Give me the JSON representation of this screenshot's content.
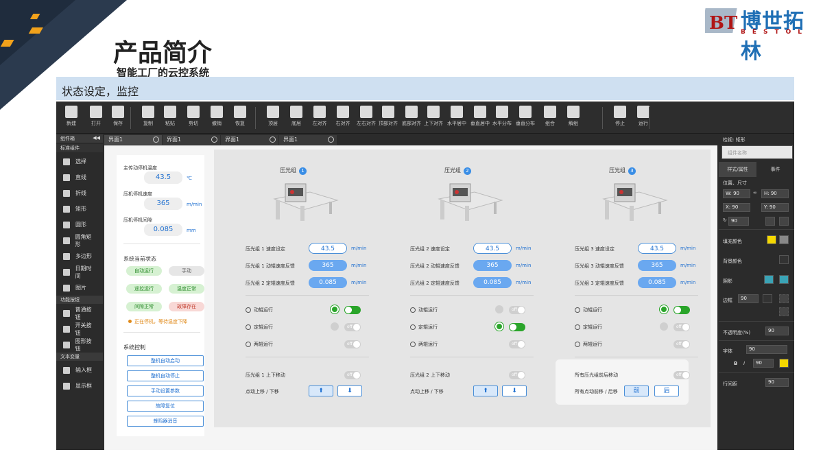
{
  "slide": {
    "title": "产品简介",
    "subtitle": "智能工厂的云控系统",
    "bar_text": "状态设定，监控",
    "logo_text": "博世拓林",
    "logo_sub": "BESTOL",
    "logo_mark": "BT"
  },
  "toolbar": [
    "新建",
    "打开",
    "保存",
    "复制",
    "粘贴",
    "剪切",
    "撤销",
    "恢复",
    "顶层",
    "底层",
    "左对齐",
    "右对齐",
    "左右对齐",
    "顶部对齐",
    "底部对齐",
    "上下对齐",
    "水平居中",
    "垂直居中",
    "水平分布",
    "垂直分布",
    "组合",
    "解组",
    "停止",
    "运行"
  ],
  "left_panel": {
    "header": "组件箱",
    "group1": "标准组件",
    "items1": [
      "选择",
      "直线",
      "折线",
      "矩形",
      "圆形",
      "圆角矩形",
      "多边形",
      "日期时间",
      "图片"
    ],
    "group2": "功能按钮",
    "items2": [
      "普通按钮",
      "开关按钮",
      "图形按钮"
    ],
    "group3": "文本变量",
    "items3": [
      "输入框",
      "显示框"
    ]
  },
  "tabs": [
    "界面1",
    "界面1",
    "界面1",
    "界面1"
  ],
  "control": {
    "f1_label": "主传动停机温度",
    "f1_value": "43.5",
    "f1_unit": "℃",
    "f2_label": "压机停机速度",
    "f2_value": "365",
    "f2_unit": "m/min",
    "f3_label": "压机停机间隙",
    "f3_value": "0.085",
    "f3_unit": "mm",
    "status_title": "系统当前状态",
    "status": [
      "自动运行",
      "手动",
      "遥控运行",
      "温度正常",
      "间隙正常",
      "故障存在"
    ],
    "warning": "正在停机，等待温度下降",
    "ctrl_title": "系统控制",
    "buttons": [
      "整机自动启动",
      "整机自动停止",
      "手动设置参数",
      "故障复位",
      "蜂鸣器消音"
    ]
  },
  "groups": [
    {
      "title": "压光组",
      "num": "1",
      "rows": [
        {
          "label": "压光组 1 速度设定",
          "value": "43.5",
          "unit": "m/min"
        },
        {
          "label": "压光组 1 动辊速度反馈",
          "value": "365",
          "unit": "m/min"
        },
        {
          "label": "压光组 2 定辊速度反馈",
          "value": "0.085",
          "unit": "m/min"
        }
      ],
      "ops": [
        "动辊运行",
        "定辊运行",
        "两辊运行"
      ],
      "bottom1": "压光组 1 上下移动",
      "bottom2": "点动上移 / 下移"
    },
    {
      "title": "压光组",
      "num": "2",
      "rows": [
        {
          "label": "压光组 2 速度设定",
          "value": "43.5",
          "unit": "m/min"
        },
        {
          "label": "压光组 2 动辊速度反馈",
          "value": "365",
          "unit": "m/min"
        },
        {
          "label": "压光组 2 定辊速度反馈",
          "value": "0.085",
          "unit": "m/min"
        }
      ],
      "ops": [
        "动辊运行",
        "定辊运行",
        "两辊运行"
      ],
      "bottom1": "压光组 2 上下移动",
      "bottom2": "点动上移 / 下移"
    },
    {
      "title": "压光组",
      "num": "3",
      "rows": [
        {
          "label": "压光组 3 速度设定",
          "value": "43.5",
          "unit": "m/min"
        },
        {
          "label": "压光组 3 动辊速度反馈",
          "value": "365",
          "unit": "m/min"
        },
        {
          "label": "压光组 3 定辊速度反馈",
          "value": "0.085",
          "unit": "m/min"
        }
      ],
      "ops": [
        "动辊运行",
        "定辊运行",
        "两辊运行"
      ],
      "bottom1": "所有压光组前后移动",
      "bottom2": "所有点动前移 / 后移",
      "front": "前",
      "back": "后"
    }
  ],
  "toggles": {
    "on": "on",
    "off": "off"
  },
  "right_panel": {
    "header": "检视: 矩形",
    "name_placeholder": "组件名称",
    "tab1": "样式/属性",
    "tab2": "事件",
    "pos_label": "位置、尺寸",
    "w": "W: 90",
    "h": "H: 90",
    "x": "X: 90",
    "y": "Y: 90",
    "rot": "90",
    "fill": "填充颜色",
    "bg": "背景颜色",
    "shadow": "阴影",
    "border": "边框",
    "border_val": "90",
    "opacity": "不透明度(%)",
    "opacity_val": "90",
    "font": "字体",
    "font_val": "90",
    "font_bold": "B",
    "font_italic": "I",
    "font_size": "90",
    "line": "行间距",
    "line_val": "90"
  },
  "colors": {
    "accent": "#1e6fd0",
    "green": "#2aa52a",
    "yellow": "#f5d800",
    "pill_blue": "#6aa8f0"
  }
}
